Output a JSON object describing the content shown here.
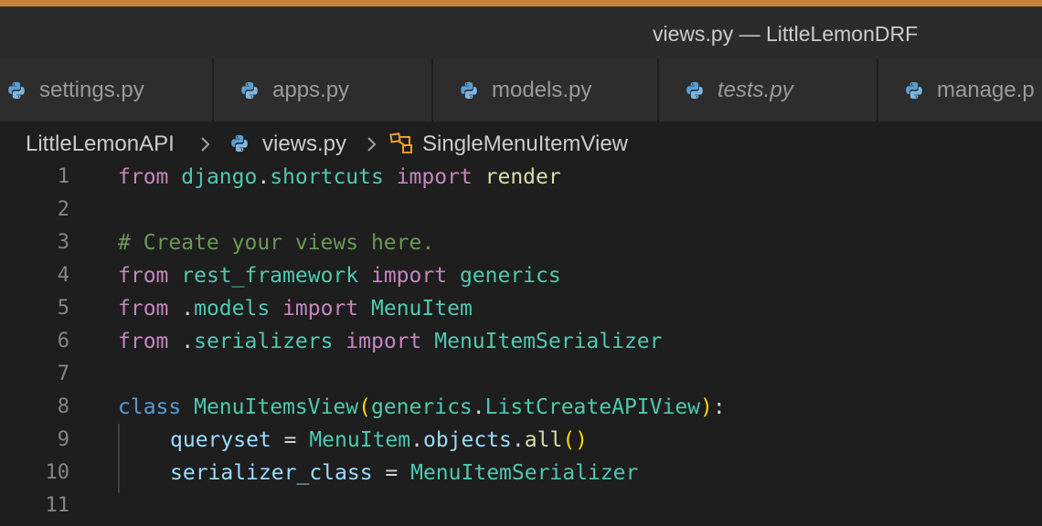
{
  "window": {
    "title": "views.py — LittleLemonDRF"
  },
  "tabs": [
    {
      "label": "settings.py",
      "italic": false
    },
    {
      "label": "apps.py",
      "italic": false
    },
    {
      "label": "models.py",
      "italic": false
    },
    {
      "label": "tests.py",
      "italic": true
    },
    {
      "label": "manage.p",
      "italic": false
    }
  ],
  "breadcrumb": {
    "folder": "LittleLemonAPI",
    "file": "views.py",
    "symbol": "SingleMenuItemView"
  },
  "editor": {
    "line_numbers": [
      "1",
      "2",
      "3",
      "4",
      "5",
      "6",
      "7",
      "8",
      "9",
      "10",
      "11"
    ],
    "lines": {
      "l1": {
        "kw1": "from",
        "mod": "django",
        "dot": ".",
        "sub": "shortcuts",
        "kw2": "import",
        "name": "render"
      },
      "l3": {
        "comment": "# Create your views here."
      },
      "l4": {
        "kw1": "from",
        "mod": "rest_framework",
        "kw2": "import",
        "name": "generics"
      },
      "l5": {
        "kw1": "from",
        "dot": ".",
        "mod": "models",
        "kw2": "import",
        "name": "MenuItem"
      },
      "l6": {
        "kw1": "from",
        "dot": ".",
        "mod": "serializers",
        "kw2": "import",
        "name": "MenuItemSerializer"
      },
      "l8": {
        "kw": "class",
        "name": "MenuItemsView",
        "open": "(",
        "base1": "generics",
        "dot": ".",
        "base2": "ListCreateAPIView",
        "close": ")",
        "colon": ":"
      },
      "l9": {
        "var": "queryset",
        "eq": " = ",
        "cls": "MenuItem",
        "dot1": ".",
        "attr": "objects",
        "dot2": ".",
        "fn": "all",
        "parens": "()"
      },
      "l10": {
        "var": "serializer_class",
        "eq": " = ",
        "cls": "MenuItemSerializer"
      }
    }
  },
  "colors": {
    "accent": "#c9803a",
    "keyword_import": "#c586c0",
    "keyword_class": "#569cd6",
    "type": "#4ec9b0",
    "function": "#dcdcaa",
    "comment": "#6a9955",
    "variable": "#9cdcfe"
  },
  "icons": {
    "tab_icon": "python-icon",
    "breadcrumb_chevron": "chevron-right-icon",
    "symbol_icon": "class-symbol-icon"
  }
}
